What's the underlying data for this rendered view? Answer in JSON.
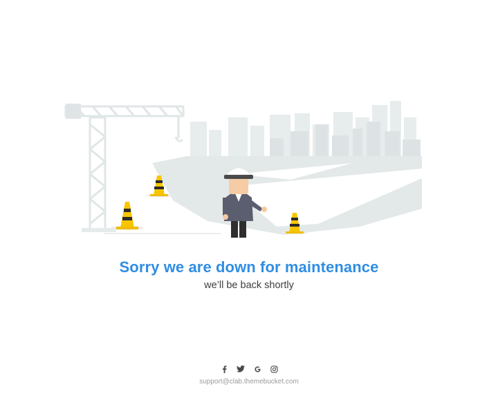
{
  "headline": "Sorry we are down for maintenance",
  "subline": "we’ll be back shortly",
  "social": [
    {
      "name": "facebook-icon",
      "glyph": "f"
    },
    {
      "name": "twitter-icon",
      "glyph": ""
    },
    {
      "name": "google-icon",
      "glyph": "G"
    },
    {
      "name": "instagram-icon",
      "glyph": ""
    }
  ],
  "support_email": "support@clab.themebucket.com",
  "colors": {
    "accent": "#2f8de4",
    "illustration_gray": "#e4e9ea",
    "cone_yellow": "#f5c400",
    "text_dark": "#3d3d3d",
    "footer_gray": "#9a9a9a"
  }
}
